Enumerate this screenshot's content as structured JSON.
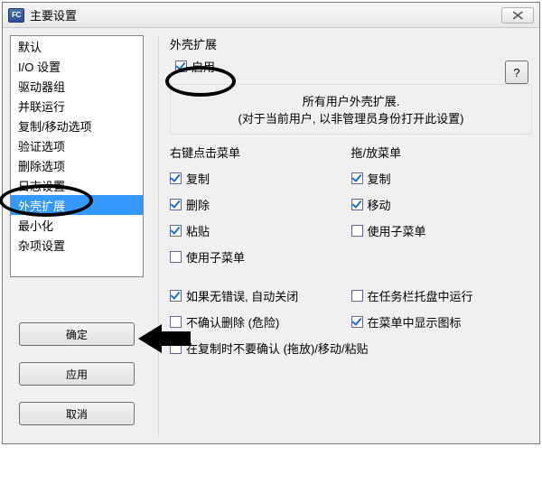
{
  "window": {
    "icon_text": "FC",
    "title": "主要设置"
  },
  "sidebar": {
    "items": [
      "默认",
      "I/O 设置",
      "驱动器组",
      "并联运行",
      "复制/移动选项",
      "验证选项",
      "删除选项",
      "日志设置",
      "外壳扩展",
      "最小化",
      "杂项设置"
    ],
    "selected_index": 8
  },
  "buttons": {
    "ok": "确定",
    "apply": "应用",
    "cancel": "取消",
    "help": "?"
  },
  "panel": {
    "title": "外壳扩展",
    "enable": {
      "label": "启用",
      "checked": true
    },
    "info": {
      "line1": "所有用户外壳扩展.",
      "line2": "(对于当前用户, 以非管理员身份打开此设置)"
    },
    "left_menu": {
      "title": "右键点击菜单",
      "options": [
        {
          "label": "复制",
          "checked": true
        },
        {
          "label": "删除",
          "checked": true
        },
        {
          "label": "粘贴",
          "checked": true
        },
        {
          "label": "使用子菜单",
          "checked": false
        }
      ]
    },
    "right_menu": {
      "title": "拖/放菜单",
      "options": [
        {
          "label": "复制",
          "checked": true
        },
        {
          "label": "移动",
          "checked": true
        },
        {
          "label": "使用子菜单",
          "checked": false
        }
      ]
    },
    "bottom": [
      [
        {
          "label": "如果无错误, 自动关闭",
          "checked": true
        },
        {
          "label": "在任务栏托盘中运行",
          "checked": false
        }
      ],
      [
        {
          "label": "不确认删除 (危险)",
          "checked": false
        },
        {
          "label": "在菜单中显示图标",
          "checked": true
        }
      ],
      [
        {
          "label": "在复制时不要确认 (拖放)/移动/粘贴",
          "checked": false
        }
      ]
    ]
  }
}
